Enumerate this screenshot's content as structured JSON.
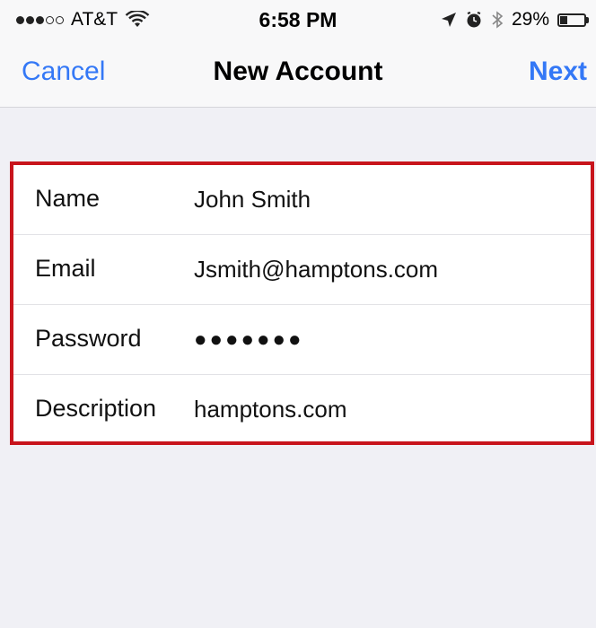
{
  "status_bar": {
    "carrier": "AT&T",
    "signal_bars_filled": 3,
    "signal_bars_total": 5,
    "time": "6:58 PM",
    "battery_percent": "29%",
    "battery_level": 0.29
  },
  "nav": {
    "cancel_label": "Cancel",
    "title": "New Account",
    "next_label": "Next"
  },
  "form": {
    "rows": [
      {
        "label": "Name",
        "value": "John Smith"
      },
      {
        "label": "Email",
        "value": "Jsmith@hamptons.com"
      },
      {
        "label": "Password",
        "value": "●●●●●●●"
      },
      {
        "label": "Description",
        "value": "hamptons.com"
      }
    ]
  },
  "colors": {
    "accent": "#3478f6",
    "highlight_border": "#c8141c",
    "background": "#f0f0f5"
  }
}
